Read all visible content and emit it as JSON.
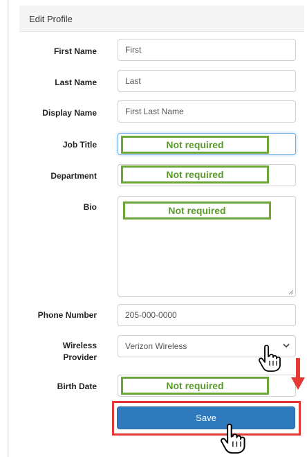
{
  "panel": {
    "title": "Edit Profile"
  },
  "fields": {
    "first_name": {
      "label": "First Name",
      "placeholder": "First"
    },
    "last_name": {
      "label": "Last Name",
      "placeholder": "Last"
    },
    "display_name": {
      "label": "Display Name",
      "placeholder": "First Last Name"
    },
    "job_title": {
      "label": "Job Title",
      "value": ""
    },
    "department": {
      "label": "Department",
      "value": ""
    },
    "bio": {
      "label": "Bio",
      "value": ""
    },
    "phone_number": {
      "label": "Phone Number",
      "placeholder": "205-000-0000"
    },
    "wireless_provider": {
      "label_line1": "Wireless",
      "label_line2": "Provider",
      "selected": "Verizon Wireless"
    },
    "birth_date": {
      "label": "Birth Date",
      "value": ""
    }
  },
  "annotations": {
    "not_required": "Not required"
  },
  "actions": {
    "save_label": "Save"
  },
  "colors": {
    "annotation_green": "#6ba63a",
    "highlight_red": "#e53935",
    "save_blue": "#2f79bd"
  },
  "icons": [
    "chevron-down-icon",
    "hand-pointer-icon",
    "down-arrow-icon"
  ]
}
